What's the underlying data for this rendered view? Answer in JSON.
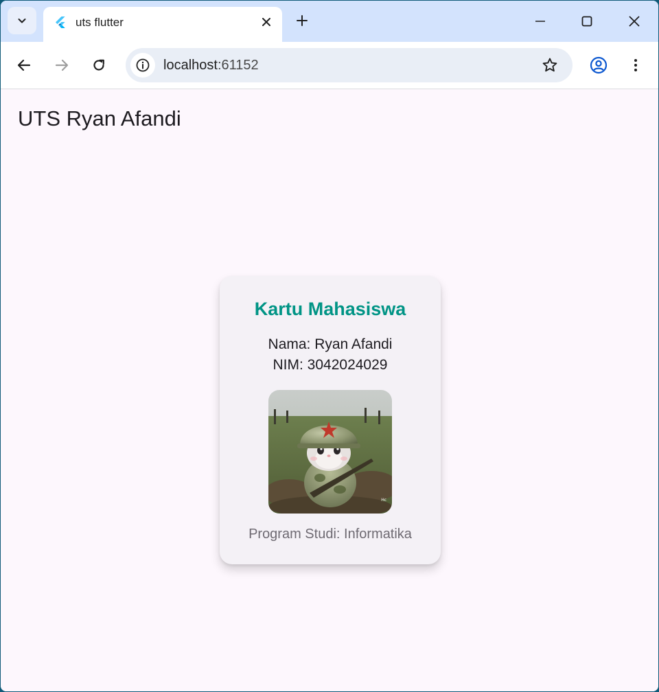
{
  "browser": {
    "tab_title": "uts flutter",
    "url_host": "localhost",
    "url_port": ":61152"
  },
  "app": {
    "appbar_title": "UTS Ryan Afandi"
  },
  "card": {
    "title": "Kartu Mahasiswa",
    "name_line": "Nama: Ryan Afandi",
    "nim_line": "NIM: 3042024029",
    "prodi_line": "Program Studi: Informatika",
    "photo_description": "cat-soldier-with-helmet-photo"
  },
  "colors": {
    "accent_title": "#009485",
    "page_bg": "#fdf7fd",
    "card_bg": "#f4f1f6",
    "tabstrip_bg": "#d3e3fd"
  }
}
